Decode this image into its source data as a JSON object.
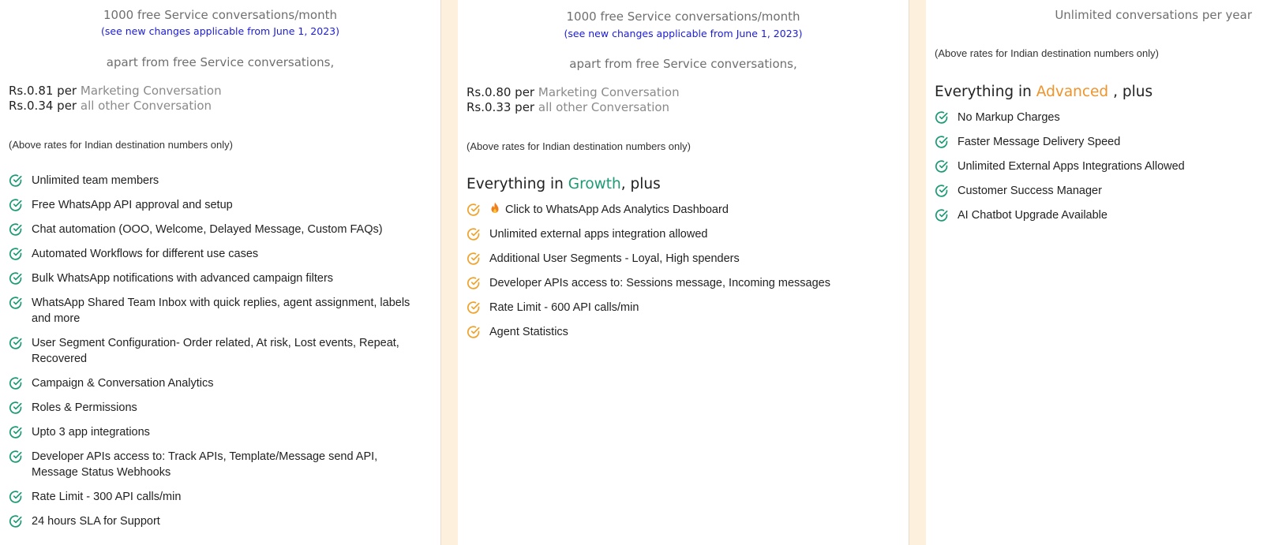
{
  "plan1": {
    "free_conversations": "1000 free Service conversations/month",
    "changes_link": "(see new changes applicable from June 1, 2023)",
    "apart_text": "apart from free Service conversations,",
    "rate_marketing_price": "Rs.0.81 per",
    "rate_marketing_label": "Marketing Conversation",
    "rate_other_price": "Rs.0.34 per",
    "rate_other_label": "all other Conversation",
    "note": "(Above rates for Indian destination numbers only)",
    "features": [
      "Unlimited team members",
      "Free WhatsApp API approval and setup",
      "Chat automation (OOO, Welcome, Delayed Message, Custom FAQs)",
      "Automated Workflows for different use cases",
      "Bulk WhatsApp notifications with advanced campaign filters",
      "WhatsApp Shared Team Inbox with quick replies, agent assignment, labels and more",
      "User Segment Configuration- Order related, At risk, Lost events, Repeat, Recovered",
      "Campaign & Conversation Analytics",
      "Roles & Permissions",
      "Upto 3 app integrations",
      "Developer APIs access to: Track APIs, Template/Message send API, Message Status Webhooks",
      "Rate Limit - 300 API calls/min",
      "24 hours SLA for Support"
    ]
  },
  "plan2": {
    "free_conversations": "1000 free Service conversations/month",
    "changes_link": "(see new changes applicable from June 1, 2023)",
    "apart_text": "apart from free Service conversations,",
    "rate_marketing_price": "Rs.0.80 per",
    "rate_marketing_label": "Marketing Conversation",
    "rate_other_price": "Rs.0.33 per",
    "rate_other_label": "all other Conversation",
    "note": "(Above rates for Indian destination numbers only)",
    "heading_prefix": "Everything in",
    "heading_highlight": "Growth",
    "heading_suffix": ", plus",
    "features": [
      "Click to WhatsApp Ads Analytics Dashboard",
      "Unlimited external apps integration allowed",
      "Additional User Segments - Loyal, High spenders",
      "Developer APIs access to: Sessions message, Incoming messages",
      "Rate Limit - 600 API calls/min",
      "Agent Statistics"
    ]
  },
  "plan3": {
    "conversations": "Unlimited conversations per year",
    "note": "(Above rates for Indian destination numbers only)",
    "heading_prefix": "Everything in",
    "heading_highlight": "Advanced",
    "heading_suffix": ", plus",
    "features": [
      "No Markup Charges",
      "Faster Message Delivery Speed",
      "Unlimited External Apps Integrations Allowed",
      "Customer Success Manager",
      "AI Chatbot Upgrade Available"
    ]
  },
  "colors": {
    "check_green": "#1b9a74",
    "check_orange": "#f0a22b",
    "link_blue": "#1b1bd6",
    "highlight_green": "#1b9a74",
    "highlight_orange": "#f0932b",
    "gutter": "#fdf0dc"
  },
  "icons": {
    "check": "check-circle-icon",
    "flame": "fire-emoji-icon"
  }
}
